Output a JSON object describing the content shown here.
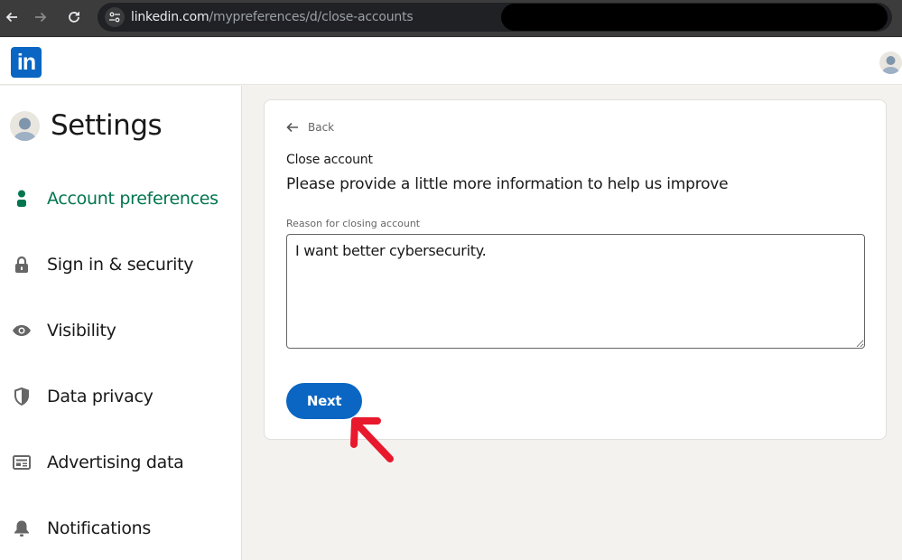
{
  "browser": {
    "url_host": "linkedin.com",
    "url_path": "/mypreferences/d/close-accounts",
    "back_icon": "arrow-left-icon",
    "forward_icon": "arrow-right-icon",
    "reload_icon": "reload-icon",
    "site_info_icon": "tune-icon"
  },
  "topnav": {
    "logo_text": "in",
    "brand_color": "#0a66c2"
  },
  "sidebar": {
    "title": "Settings",
    "active_color": "#01754f",
    "items": [
      {
        "label": "Account preferences",
        "icon": "person-icon",
        "active": true
      },
      {
        "label": "Sign in & security",
        "icon": "lock-icon",
        "active": false
      },
      {
        "label": "Visibility",
        "icon": "eye-icon",
        "active": false
      },
      {
        "label": "Data privacy",
        "icon": "shield-icon",
        "active": false
      },
      {
        "label": "Advertising data",
        "icon": "ad-icon",
        "active": false
      },
      {
        "label": "Notifications",
        "icon": "bell-icon",
        "active": false
      }
    ]
  },
  "main": {
    "back_label": "Back",
    "section_title": "Close account",
    "section_subtitle": "Please provide a little more information to help us improve",
    "reason_label": "Reason for closing account",
    "reason_value": "I want better cybersecurity.",
    "next_label": "Next",
    "button_color": "#0a66c2"
  },
  "annotation": {
    "type": "arrow",
    "color": "#e8192c",
    "points_to": "next-button"
  }
}
